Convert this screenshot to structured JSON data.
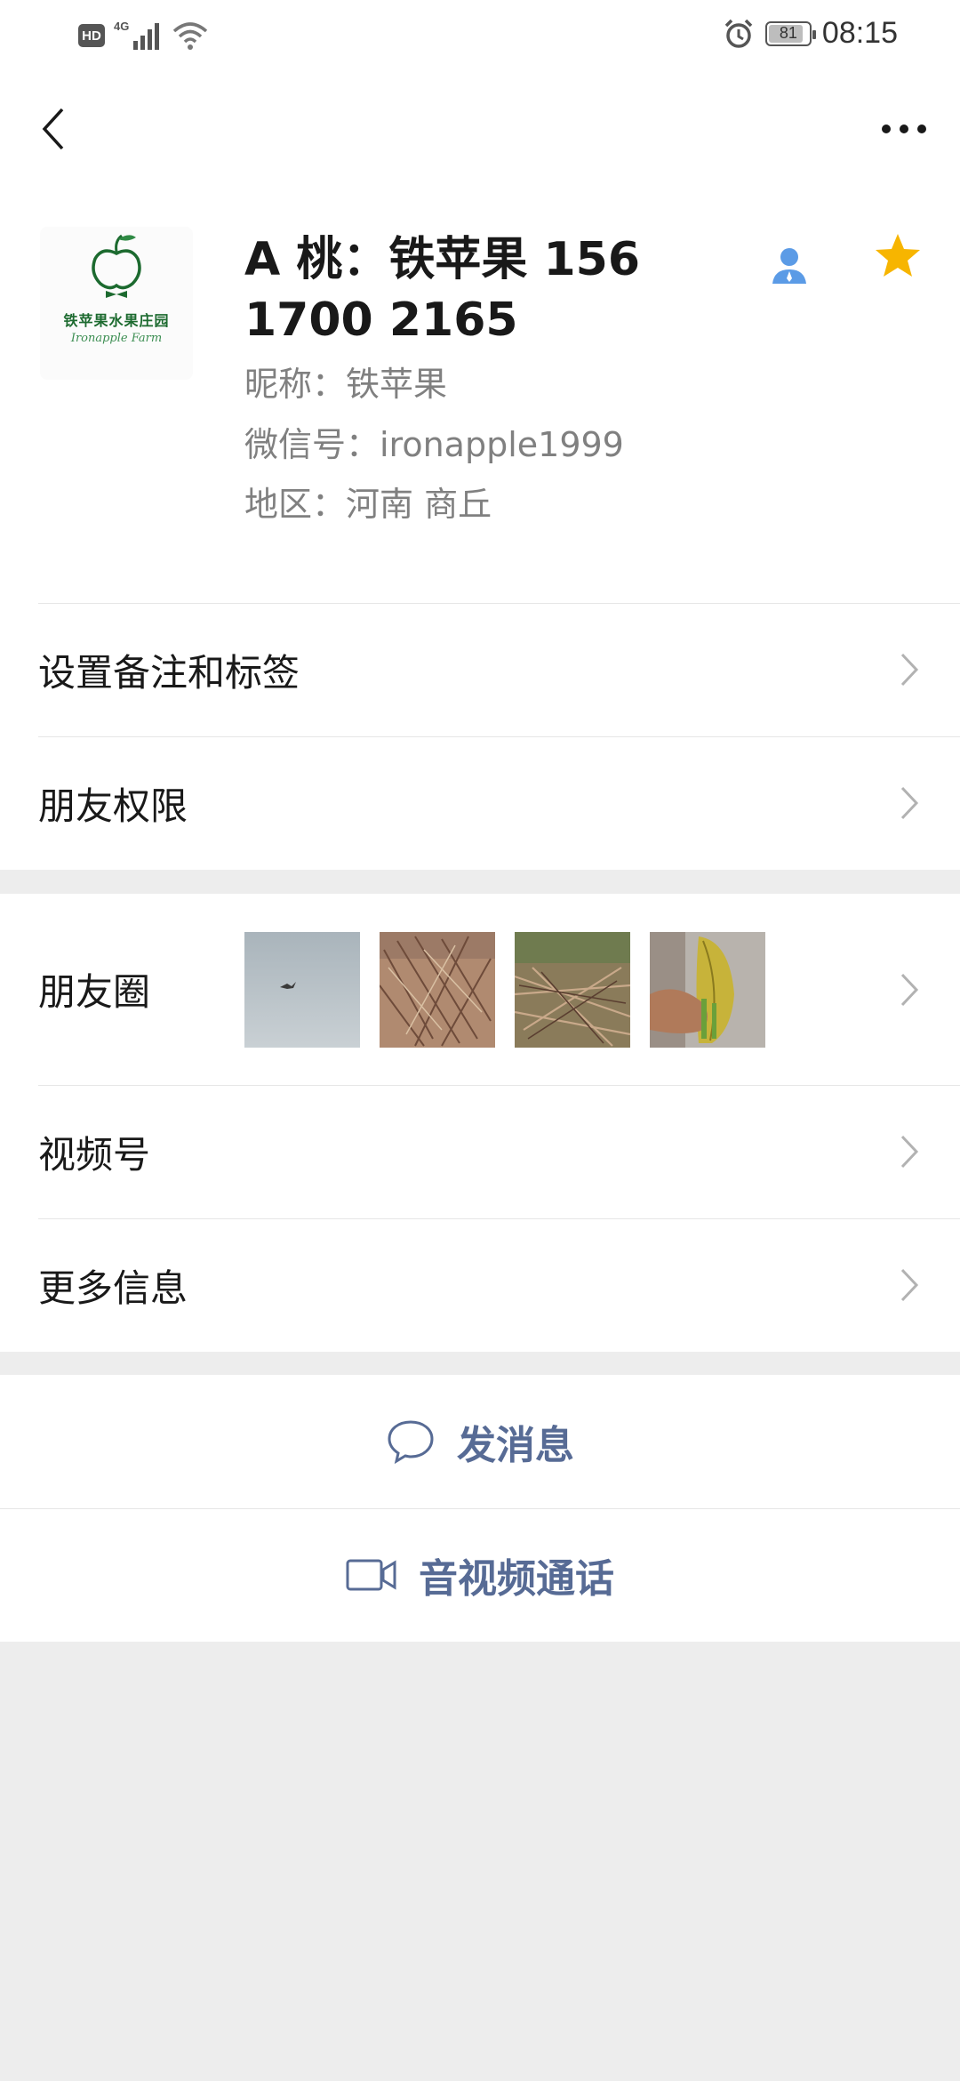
{
  "status_bar": {
    "hd_label": "HD",
    "network_label": "4G",
    "battery_level": "81",
    "time": "08:15",
    "icons": [
      "hd-icon",
      "signal-icon",
      "wifi-icon",
      "alarm-icon",
      "battery-icon"
    ]
  },
  "nav": {
    "back_icon": "chevron-left-icon",
    "more_icon": "more-horizontal-icon"
  },
  "profile": {
    "avatar_text": "铁苹果水果庄园",
    "avatar_subtext": "Ironapple Farm",
    "name": "A 桃：铁苹果 156 1700 2165",
    "nickname": "昵称：铁苹果",
    "wechat_id": "微信号：ironapple1999",
    "region": "地区：河南  商丘",
    "contact_icon": "person-icon",
    "star_icon": "star-icon",
    "star_color": "#f7b500"
  },
  "menu": {
    "remark_tags": "设置备注和标签",
    "friend_permissions": "朋友权限",
    "moments": "朋友圈",
    "channels": "视频号",
    "more_info": "更多信息"
  },
  "moments_thumbs": [
    "bird-in-sky-photo",
    "seedling-bundle-photo",
    "seedling-pile-photo",
    "hand-holding-leaf-photo"
  ],
  "actions": {
    "send_message": "发消息",
    "video_call": "音视频通话",
    "message_icon": "chat-bubble-icon",
    "video_icon": "video-camera-icon",
    "action_color": "#576b95"
  }
}
